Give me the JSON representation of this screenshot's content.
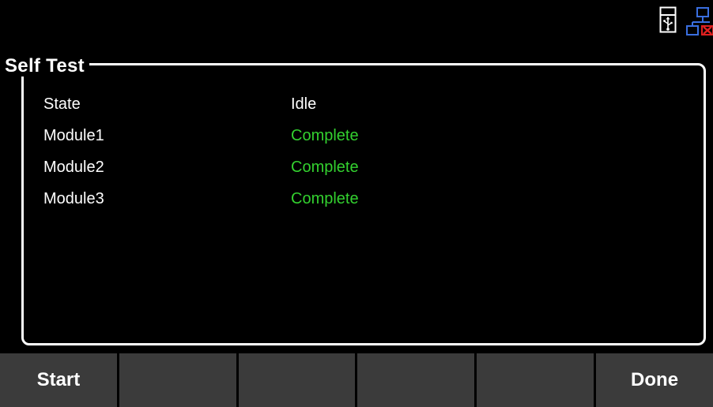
{
  "status_bar": {
    "icons": [
      "usb-icon",
      "network-disconnected-icon"
    ],
    "colors": {
      "network_blue": "#3a6fe0",
      "network_error_red": "#e02020"
    }
  },
  "self_test": {
    "title": "Self Test",
    "rows": [
      {
        "label": "State",
        "value": "Idle",
        "status": "neutral"
      },
      {
        "label": "Module1",
        "value": "Complete",
        "status": "ok"
      },
      {
        "label": "Module2",
        "value": "Complete",
        "status": "ok"
      },
      {
        "label": "Module3",
        "value": "Complete",
        "status": "ok"
      }
    ],
    "colors": {
      "complete": "#33d12f",
      "text": "#ffffff",
      "background": "#000000"
    }
  },
  "softkeys": {
    "start_label": "Start",
    "key2_label": "",
    "key3_label": "",
    "key4_label": "",
    "key5_label": "",
    "done_label": "Done",
    "background_color": "#3b3b3b"
  }
}
